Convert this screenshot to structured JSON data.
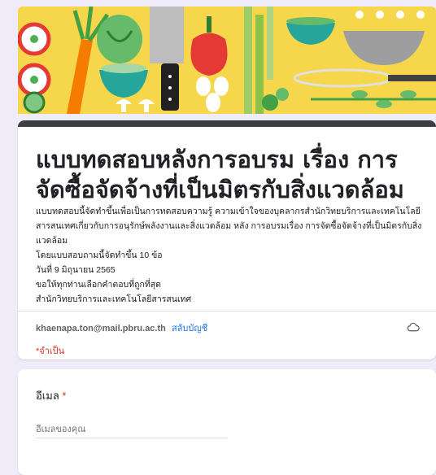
{
  "form": {
    "title": "แบบทดสอบหลังการอบรม เรื่อง การจัดซื้อจัดจ้างที่เป็นมิตรกับสิ่งแวดล้อม",
    "description": "แบบทดสอบนี้จัดทำขึ้นเพื่อเป็นการทดสอบความรู้ ความเข้าใจของบุคลากรสำนักวิทยบริการและเทคโนโลยีสารสนเทศเกี่ยวกับการอนุรักษ์พลังงานและสิ่งแวดล้อม หลัง การอบรมเรื่อง การจัดซื้อจัดจ้างที่เป็นมิตรกับสิ่งแวดล้อม\nโดยแบบสอบถามนี้จัดทำขึ้น 10 ข้อ\nวันที่ 9 มิถุนายน 2565\nขอให้ทุกท่านเลือกคำตอบที่ถูกที่สุด\nสำนักวิทยบริการและเทคโนโลยีสารสนเทศ",
    "account_email": "khaenapa.ton@mail.pbru.ac.th",
    "switch_account": "สลับบัญชี",
    "required_note": "*จำเป็น",
    "cloud_icon": "cloud-icon"
  },
  "email_question": {
    "label": "อีเมล",
    "required_mark": "*",
    "placeholder": "อีเมลของคุณ"
  },
  "header_image": {
    "background_color": "#f6d64a",
    "icons": [
      "tomato-slice-icon",
      "carrot-icon",
      "lettuce-icon",
      "bowl-icon",
      "knife-icon",
      "bell-pepper-icon",
      "celery-icon",
      "whisk-icon",
      "colander-icon",
      "mushroom-icon",
      "eggs-icon",
      "herb-icon"
    ]
  },
  "colors": {
    "accent": "#3c4043",
    "link": "#1a73e8",
    "required": "#d93025",
    "page_bg": "#f0ebf8"
  }
}
